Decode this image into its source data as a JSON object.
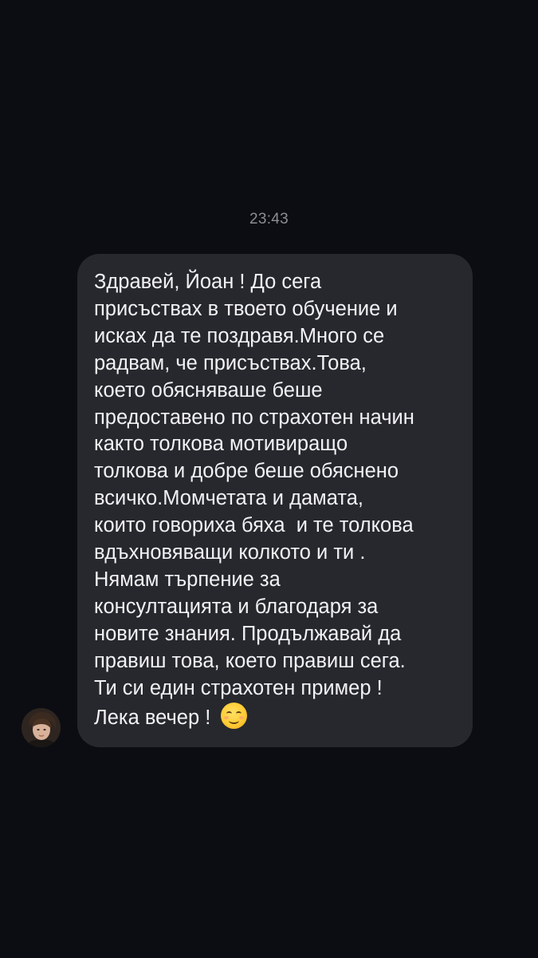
{
  "chat": {
    "timestamp": "23:43",
    "message": {
      "lines": [
        "Здравей, Йоан ! До сега",
        "присъствах в твоето обучение и",
        "исках да те поздравя.Много се",
        "радвам, че присъствах.Това,",
        "което обясняваше беше",
        "предоставено по страхотен начин",
        "както толкова мотивиращо",
        "толкова и добре беше обяснено",
        "всичко.Момчетата и дамата,",
        "които говориха бяха  и те толкова",
        "вдъхновяващи колкото и ти .",
        "Нямам търпение за",
        "консултацията и благодаря за",
        "новите знания. Продължавай да",
        "правиш това, което правиш сега.",
        "Ти си един страхотен пример !",
        "Лека вечер ! "
      ],
      "emoji": "smiling-face-with-smiling-eyes-icon"
    },
    "sender_avatar": "avatar"
  },
  "colors": {
    "background": "#0c0d12",
    "bubble": "#26282e",
    "text": "#f2f2f4",
    "timestamp": "#8b8d94"
  }
}
